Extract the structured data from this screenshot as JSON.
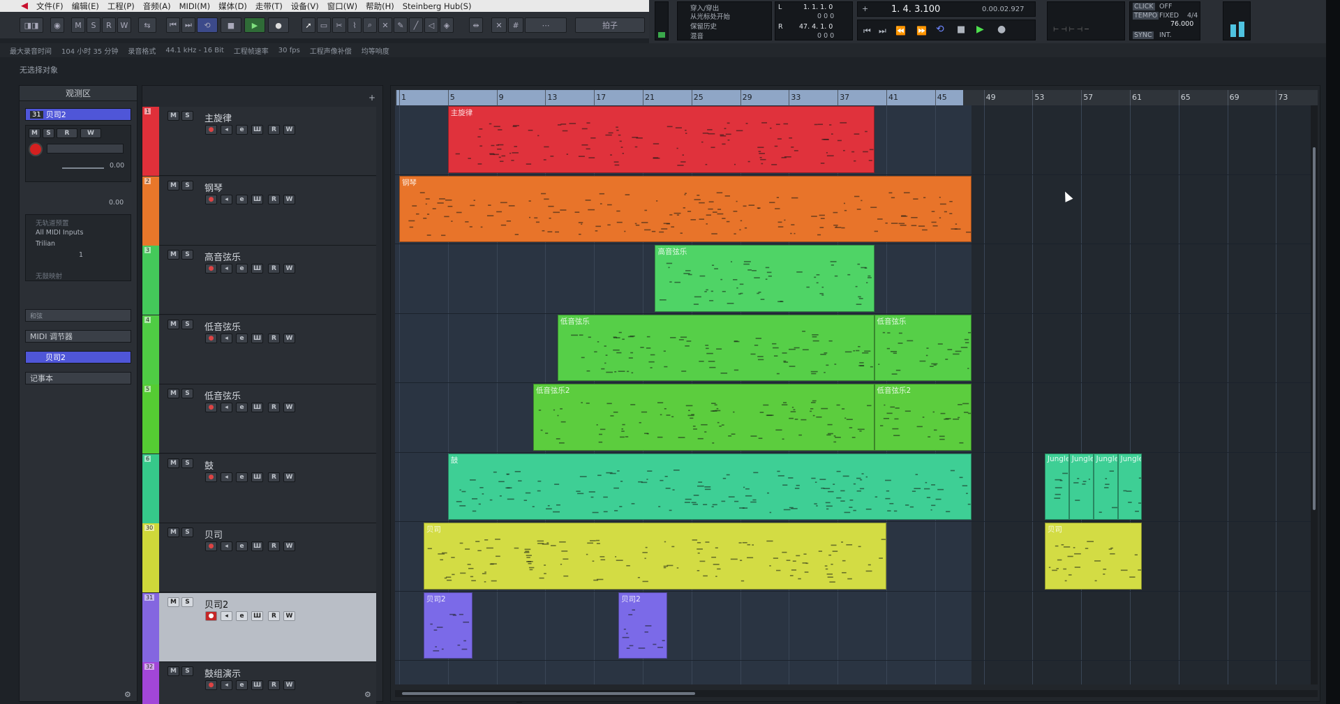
{
  "menu": {
    "items": [
      "文件(F)",
      "编辑(E)",
      "工程(P)",
      "音频(A)",
      "MIDI(M)",
      "媒体(D)",
      "走带(T)",
      "设备(V)",
      "窗口(W)",
      "帮助(H)",
      "Steinberg Hub(S)"
    ]
  },
  "toolbar": {
    "mode_labels": [
      "M",
      "S",
      "R",
      "W"
    ],
    "sync_label": "拍子"
  },
  "transport": {
    "punch_labels": [
      "穿入/穿出",
      "从光标处开始",
      "保留历史",
      "混音"
    ],
    "left_locator": "1. 1. 1. 0",
    "left_locator2": "0 0 0",
    "right_locator": "47. 4. 1. 0",
    "right_locator2": "0 0 0",
    "position_bars": "1. 4. 3.100",
    "position_time": "0.00.02.927",
    "click_label": "CLICK",
    "click_value": "OFF",
    "tempo_label": "TEMPO",
    "tempo_mode": "FIXED",
    "signature": "4/4",
    "tempo_value": "76.000",
    "sync_label": "SYNC",
    "sync_value": "INT."
  },
  "status": {
    "max_rec_label": "最大录音时间",
    "max_rec_value": "104 小时 35 分钟",
    "rec_format_label": "录音格式",
    "rec_format_value": "44.1 kHz - 16 Bit",
    "framerate_label": "工程帧速率",
    "framerate_value": "30 fps",
    "pan_label": "工程声像补偿",
    "pan_value": "均等响度"
  },
  "info_line": "无选择对象",
  "inspector": {
    "title": "观测区",
    "track_number": "31",
    "track_name": "贝司2",
    "volume": "0.00",
    "pan": "0.00",
    "input": "All MIDI Inputs",
    "output": "Trilian",
    "channel": "1",
    "sections": [
      "和弦",
      "MIDI 调节器",
      "贝司2",
      "记事本"
    ],
    "in_filter": "无轨道预置",
    "no_mapping": "无鼓映射"
  },
  "tracks": [
    {
      "num": "1",
      "name": "主旋律",
      "color": "#e0303a",
      "sel": false
    },
    {
      "num": "2",
      "name": "钢琴",
      "color": "#e8772a",
      "sel": false
    },
    {
      "num": "3",
      "name": "高音弦乐",
      "color": "#44c95a",
      "sel": false
    },
    {
      "num": "4",
      "name": "低音弦乐",
      "color": "#4fcc44",
      "sel": false
    },
    {
      "num": "5",
      "name": "低音弦乐",
      "color": "#55cc33",
      "sel": false
    },
    {
      "num": "6",
      "name": "鼓",
      "color": "#36c98a",
      "sel": false
    },
    {
      "num": "30",
      "name": "贝司",
      "color": "#cfd83a",
      "sel": false
    },
    {
      "num": "31",
      "name": "贝司2",
      "color": "#8466e0",
      "sel": true
    },
    {
      "num": "32",
      "name": "鼓组演示",
      "color": "#a246d8",
      "sel": false
    }
  ],
  "ruler": {
    "bars": [
      "1",
      "5",
      "9",
      "13",
      "17",
      "21",
      "25",
      "29",
      "33",
      "37",
      "41",
      "45",
      "49",
      "53",
      "57",
      "61",
      "65",
      "69",
      "73"
    ]
  },
  "regions": [
    {
      "track": 0,
      "start": 4,
      "end": 39,
      "label": "主旋律",
      "color": "#e0323c"
    },
    {
      "track": 1,
      "start": 0,
      "end": 47,
      "label": "钢琴",
      "color": "#e8742a"
    },
    {
      "track": 2,
      "start": 21,
      "end": 39,
      "label": "高音弦乐",
      "color": "#4fd466"
    },
    {
      "track": 3,
      "start": 13,
      "end": 39,
      "label": "低音弦乐",
      "color": "#56cf48"
    },
    {
      "track": 3,
      "start": 39,
      "end": 47,
      "label": "低音弦乐",
      "color": "#56cf48"
    },
    {
      "track": 4,
      "start": 11,
      "end": 39,
      "label": "低音弦乐2",
      "color": "#5ccd3e"
    },
    {
      "track": 4,
      "start": 39,
      "end": 47,
      "label": "低音弦乐2",
      "color": "#5ccd3e"
    },
    {
      "track": 5,
      "start": 4,
      "end": 47,
      "label": "鼓",
      "color": "#3ecf95"
    },
    {
      "track": 5,
      "start": 53,
      "end": 55,
      "label": "Jungle",
      "color": "#3ecf95"
    },
    {
      "track": 5,
      "start": 55,
      "end": 57,
      "label": "Jungle",
      "color": "#3ecf95"
    },
    {
      "track": 5,
      "start": 57,
      "end": 59,
      "label": "Jungle",
      "color": "#3ecf95"
    },
    {
      "track": 5,
      "start": 59,
      "end": 61,
      "label": "Jungle",
      "color": "#3ecf95"
    },
    {
      "track": 6,
      "start": 2,
      "end": 40,
      "label": "贝司",
      "color": "#d3dc44"
    },
    {
      "track": 6,
      "start": 53,
      "end": 61,
      "label": "贝司",
      "color": "#d3dc44"
    },
    {
      "track": 7,
      "start": 2,
      "end": 6,
      "label": "贝司2",
      "color": "#7b6ae8"
    },
    {
      "track": 7,
      "start": 18,
      "end": 22,
      "label": "贝司2",
      "color": "#7b6ae8"
    }
  ]
}
